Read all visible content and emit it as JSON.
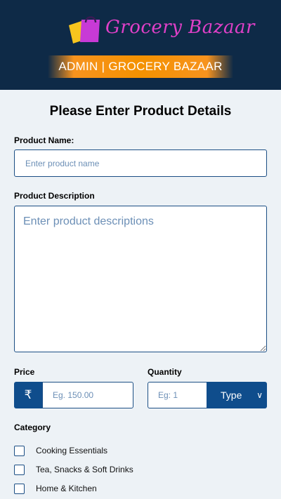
{
  "header": {
    "logo_text": "Grocery Bazaar",
    "logo_icon": "shopping-bag-icon",
    "admin_title": "ADMIN | GROCERY BAZAAR",
    "bg_color": "#0e2a47",
    "banner_color": "#f49200"
  },
  "form": {
    "title": "Please Enter Product Details",
    "name_label": "Product Name:",
    "name_placeholder": "Enter product name",
    "desc_label": "Product Description",
    "desc_placeholder": "Enter product descriptions",
    "price_label": "Price",
    "price_symbol": "₹",
    "price_placeholder": "Eg. 150.00",
    "qty_label": "Quantity",
    "qty_placeholder": "Eg: 1",
    "type_value": "Type",
    "category_label": "Category",
    "categories": [
      {
        "label": "Cooking Essentials",
        "checked": false
      },
      {
        "label": "Tea, Snacks & Soft Drinks",
        "checked": false
      },
      {
        "label": "Home & Kitchen",
        "checked": false
      }
    ],
    "accent_color": "#0f4d8c"
  }
}
